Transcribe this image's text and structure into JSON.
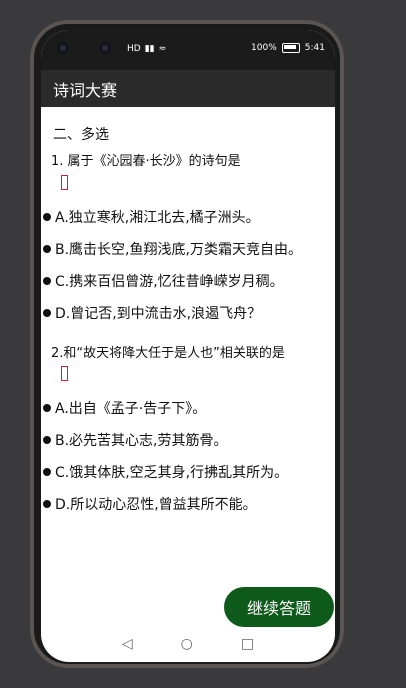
{
  "status": {
    "signal_text": "HD",
    "battery_text": "100%",
    "time": "5:41"
  },
  "app": {
    "title": "诗词大赛"
  },
  "quiz": {
    "section_title": "二、多选",
    "questions": [
      {
        "text": "1. 属于《沁园春·长沙》的诗句是",
        "options": [
          "A.独立寒秋,湘江北去,橘子洲头。",
          "B.鹰击长空,鱼翔浅底,万类霜天竞自由。",
          "C.携来百侣曾游,忆往昔峥嵘岁月稠。",
          "D.曾记否,到中流击水,浪遏飞舟？"
        ]
      },
      {
        "text": "2.和“故天将降大任于是人也”相关联的是",
        "options": [
          "A.出自《孟子·告子下》。",
          "B.必先苦其心志,劳其筋骨。",
          "C.饿其体肤,空乏其身,行拂乱其所为。",
          "D.所以动心忍性,曾益其所不能。"
        ]
      }
    ],
    "continue_label": "继续答题"
  },
  "nav": {
    "back_icon": "◁",
    "home_icon": "○",
    "recent_icon": "□"
  },
  "colors": {
    "accent": "#0e5a1a",
    "appbar": "#2b2b2b",
    "check_border": "#d0203a"
  }
}
